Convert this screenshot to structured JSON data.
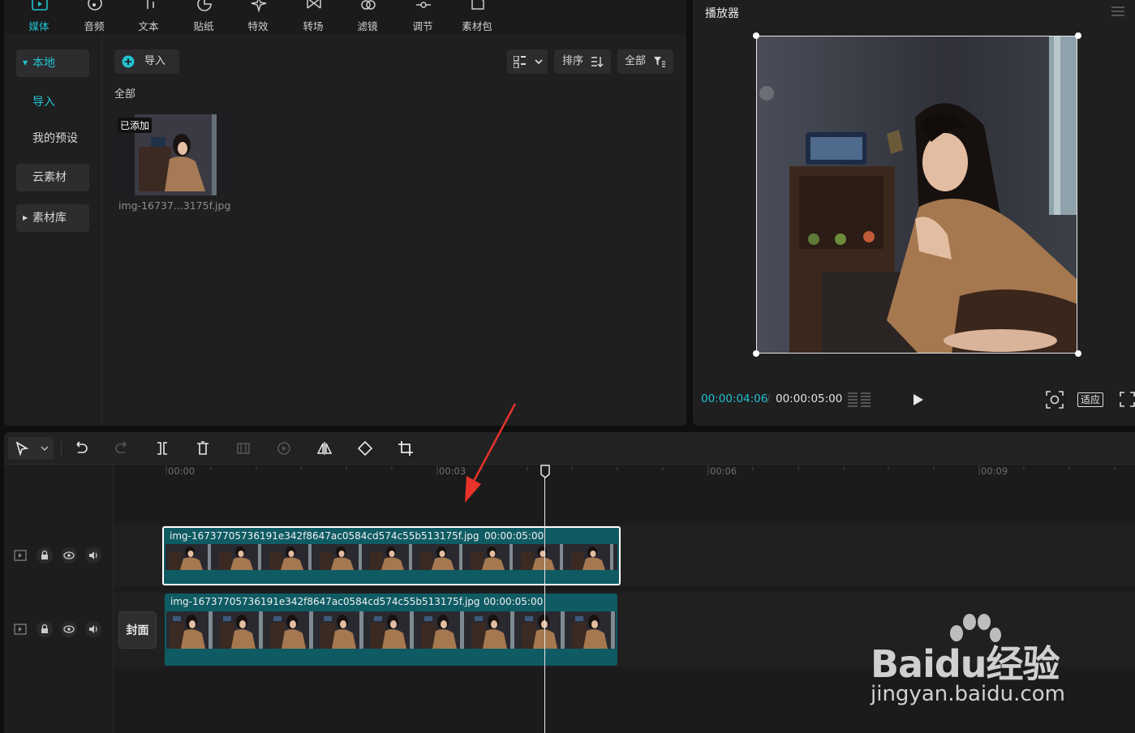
{
  "tabs": [
    {
      "label": "媒体",
      "icon": "media-icon",
      "active": true
    },
    {
      "label": "音频",
      "icon": "audio-icon"
    },
    {
      "label": "文本",
      "icon": "text-icon"
    },
    {
      "label": "贴纸",
      "icon": "sticker-icon"
    },
    {
      "label": "特效",
      "icon": "effects-icon"
    },
    {
      "label": "转场",
      "icon": "transition-icon"
    },
    {
      "label": "滤镜",
      "icon": "filter-icon"
    },
    {
      "label": "调节",
      "icon": "adjust-icon"
    },
    {
      "label": "素材包",
      "icon": "package-icon"
    }
  ],
  "sidebar": {
    "items": [
      {
        "label": "本地"
      },
      {
        "label": "导入"
      },
      {
        "label": "我的预设"
      },
      {
        "label": "云素材"
      },
      {
        "label": "素材库"
      }
    ]
  },
  "media": {
    "import_label": "导入",
    "sort_label": "排序",
    "filter_label": "全部",
    "section_label": "全部",
    "item": {
      "badge": "已添加",
      "filename": "img-16737...3175f.jpg"
    }
  },
  "player": {
    "title": "播放器",
    "current_time": "00:00:04:06",
    "total_time": "00:00:05:00",
    "fit_label": "适应"
  },
  "timeline": {
    "ruler": [
      "00:00",
      "00:03",
      "00:06",
      "00:09"
    ],
    "cover_label": "封面",
    "clips": [
      {
        "name": "img-16737705736191e342f8647ac0584cd574c55b513175f.jpg",
        "duration": "00:00:05:00"
      },
      {
        "name": "img-16737705736191e342f8647ac0584cd574c55b513175f.jpg",
        "duration": "00:00:05:00"
      }
    ]
  },
  "watermark": {
    "brand": "Baidu经验",
    "url": "jingyan.baidu.com"
  },
  "colors": {
    "accent": "#21c1cf",
    "clip": "#0f5b63",
    "arrow": "#e8322a"
  }
}
